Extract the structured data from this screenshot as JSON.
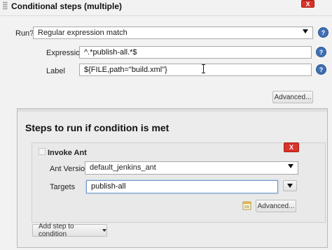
{
  "section": {
    "title": "Conditional steps (multiple)",
    "delete_label": "X"
  },
  "run": {
    "label": "Run?",
    "selected": "Regular expression match"
  },
  "expression": {
    "label": "Expression",
    "value": "^.*publish-all.*$"
  },
  "label_field": {
    "label": "Label",
    "value": "${FILE,path=\"build.xml\"}"
  },
  "advanced_button": "Advanced...",
  "steps": {
    "title": "Steps to run if condition is met",
    "builder": {
      "title": "Invoke Ant",
      "delete_label": "X",
      "ant_version_label": "Ant Version",
      "ant_version_selected": "default_jenkins_ant",
      "targets_label": "Targets",
      "targets_value": "publish-all",
      "advanced_button": "Advanced..."
    },
    "add_step_button": "Add step to condition"
  },
  "help_icon_text": "?",
  "icons": [
    "drag-handle-icon",
    "help-icon",
    "chevron-down-icon",
    "expand-icon",
    "notepad-icon",
    "text-cursor-icon"
  ]
}
